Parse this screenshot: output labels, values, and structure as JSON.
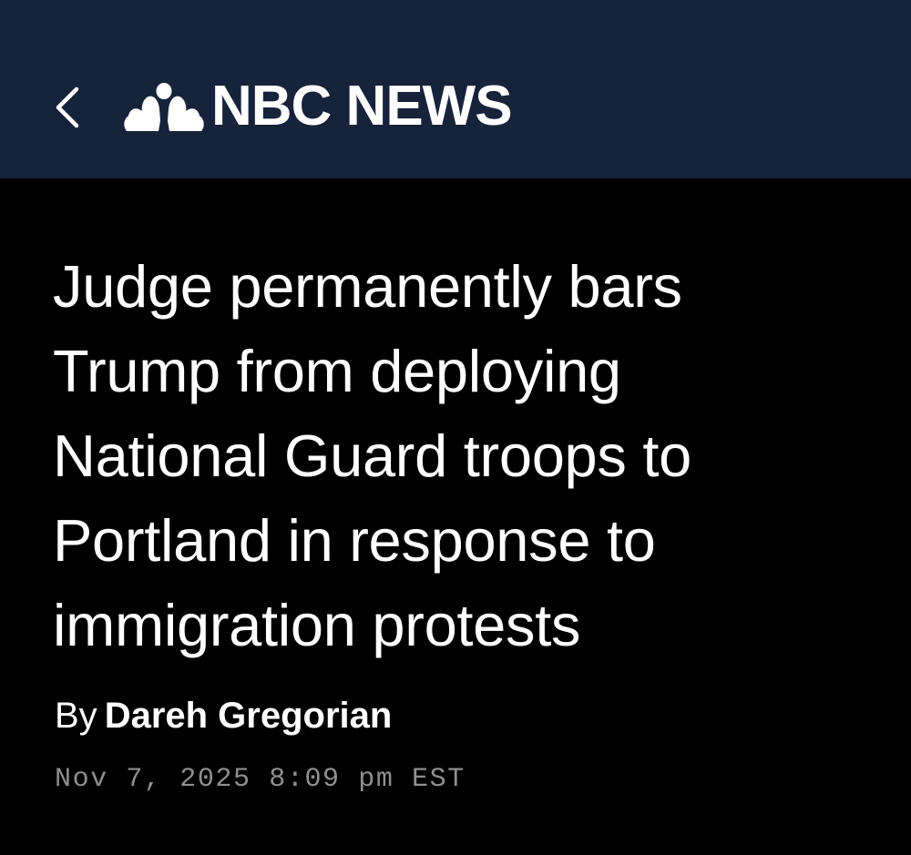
{
  "header": {
    "back_icon": "chevron-left-icon",
    "logo_icon": "nbc-peacock-icon",
    "logo_text": "NBC NEWS",
    "background": "#17223b"
  },
  "article": {
    "headline_lines": [
      "Judge permanently bars",
      "Trump from deploying",
      "National Guard troops to",
      "Portland in response to",
      "immigration protests"
    ],
    "byline_prefix": "By",
    "author": "Dareh Gregorian",
    "timestamp": "Nov 7, 2025 8:09 pm EST",
    "background": "#000000"
  }
}
